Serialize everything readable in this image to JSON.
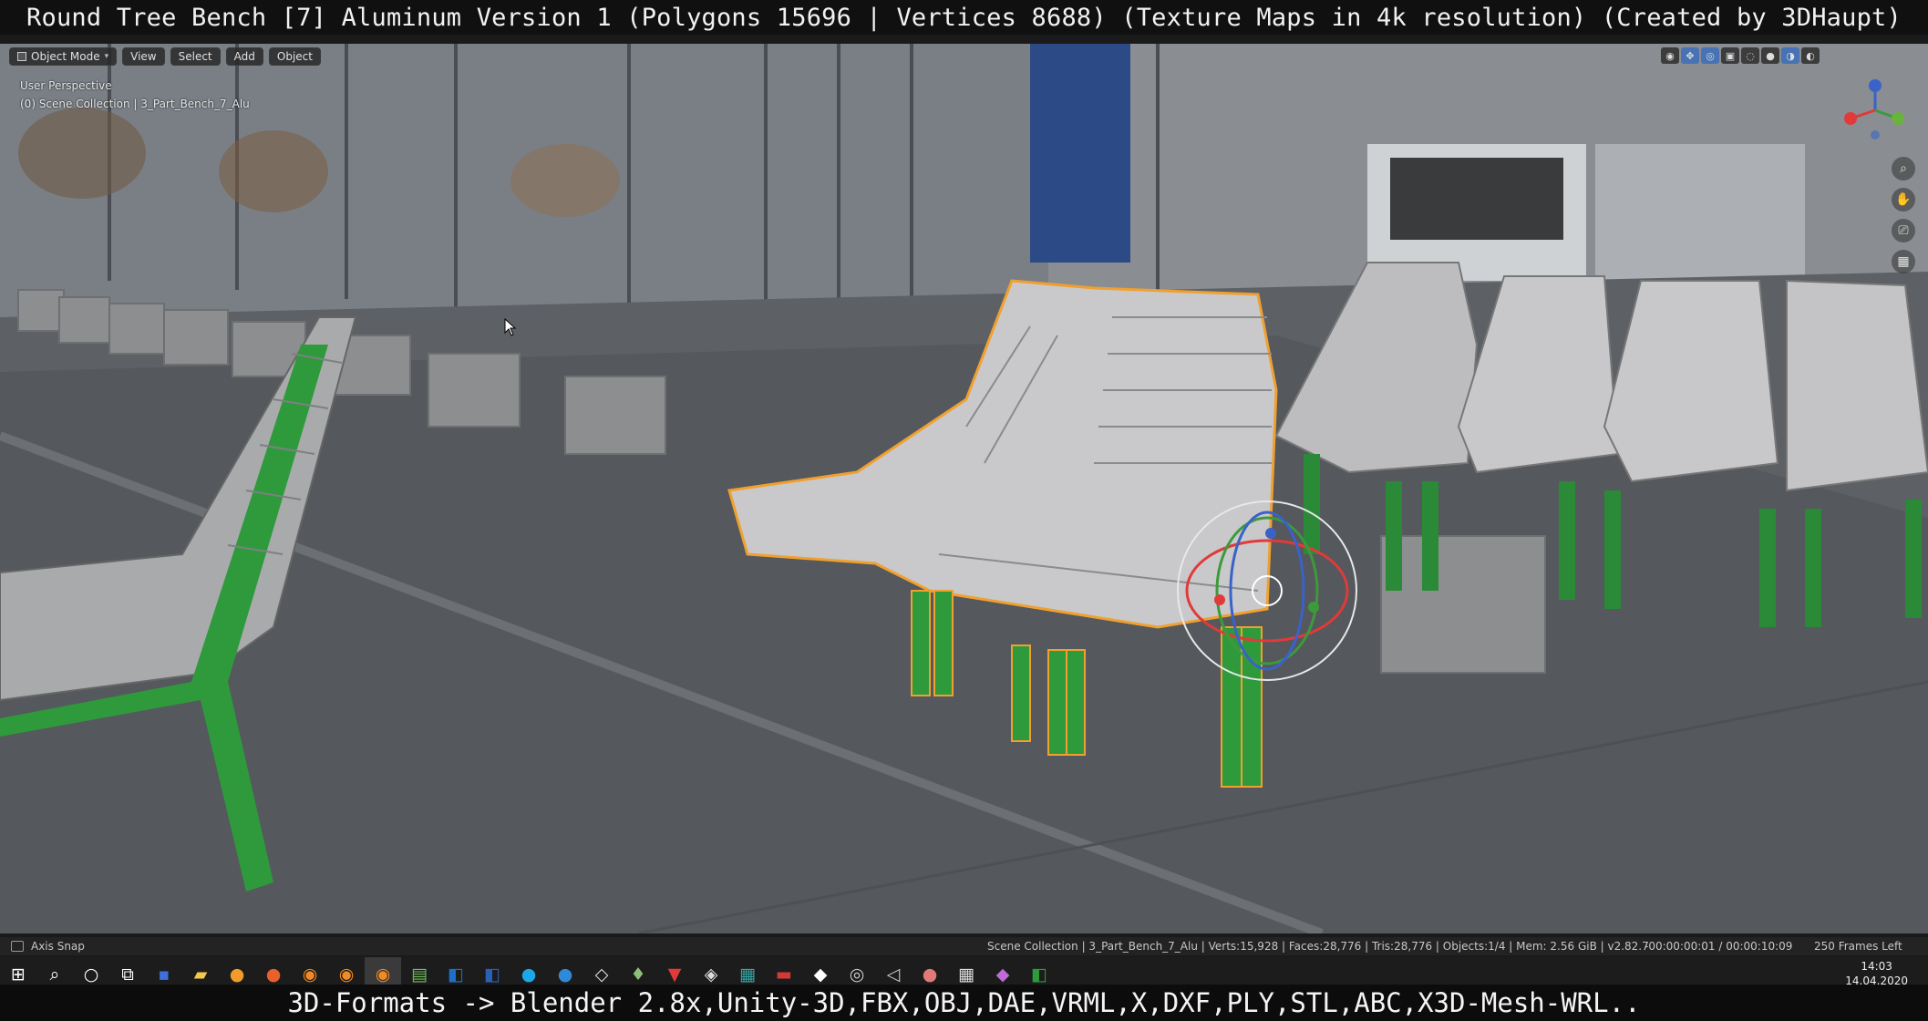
{
  "title": "Round Tree Bench [7] Aluminum Version 1 (Polygons 15696 | Vertices 8688) (Texture Maps in 4k resolution) (Created by 3DHaupt)",
  "viewport_header": {
    "mode": "Object Mode",
    "menus": [
      "View",
      "Select",
      "Add",
      "Object"
    ]
  },
  "viewport_info": {
    "perspective": "User Perspective",
    "collection": "(0) Scene Collection | 3_Part_Bench_7_Alu"
  },
  "status_bar": {
    "left": "Axis Snap",
    "stats": "Scene Collection | 3_Part_Bench_7_Alu | Verts:15,928 | Faces:28,776 | Tris:28,776 | Objects:1/4 | Mem: 2.56 GiB | v2.82.7",
    "timecode": "-00:00:00:01 / 00:00:10:09",
    "frames": "250 Frames Left"
  },
  "taskbar": {
    "time": "14:03",
    "date": "14.04.2020",
    "icons": [
      "windows-start",
      "search",
      "cortana",
      "task-view",
      "save",
      "file-explorer",
      "firefox-dev",
      "firefox",
      "blender",
      "blender",
      "blender-active",
      "notepad",
      "outlook",
      "word",
      "skype",
      "edge",
      "3d-viewer",
      "plugin",
      "vivaldi",
      "unity",
      "3dsmax",
      "acrobat",
      "unity-hub",
      "obs",
      "unreal",
      "paint3d",
      "calculator",
      "maps",
      "excel"
    ]
  },
  "caption": "3D-Formats -> Blender 2.8x,Unity-3D,FBX,OBJ,DAE,VRML,X,DXF,PLY,STL,ABC,X3D-Mesh-WRL..",
  "colors": {
    "selection_outline": "#f0a030",
    "bench_leg": "#2f9a3c",
    "bench_slat": "#cfcfd0",
    "active_tab": "#4772b3"
  }
}
